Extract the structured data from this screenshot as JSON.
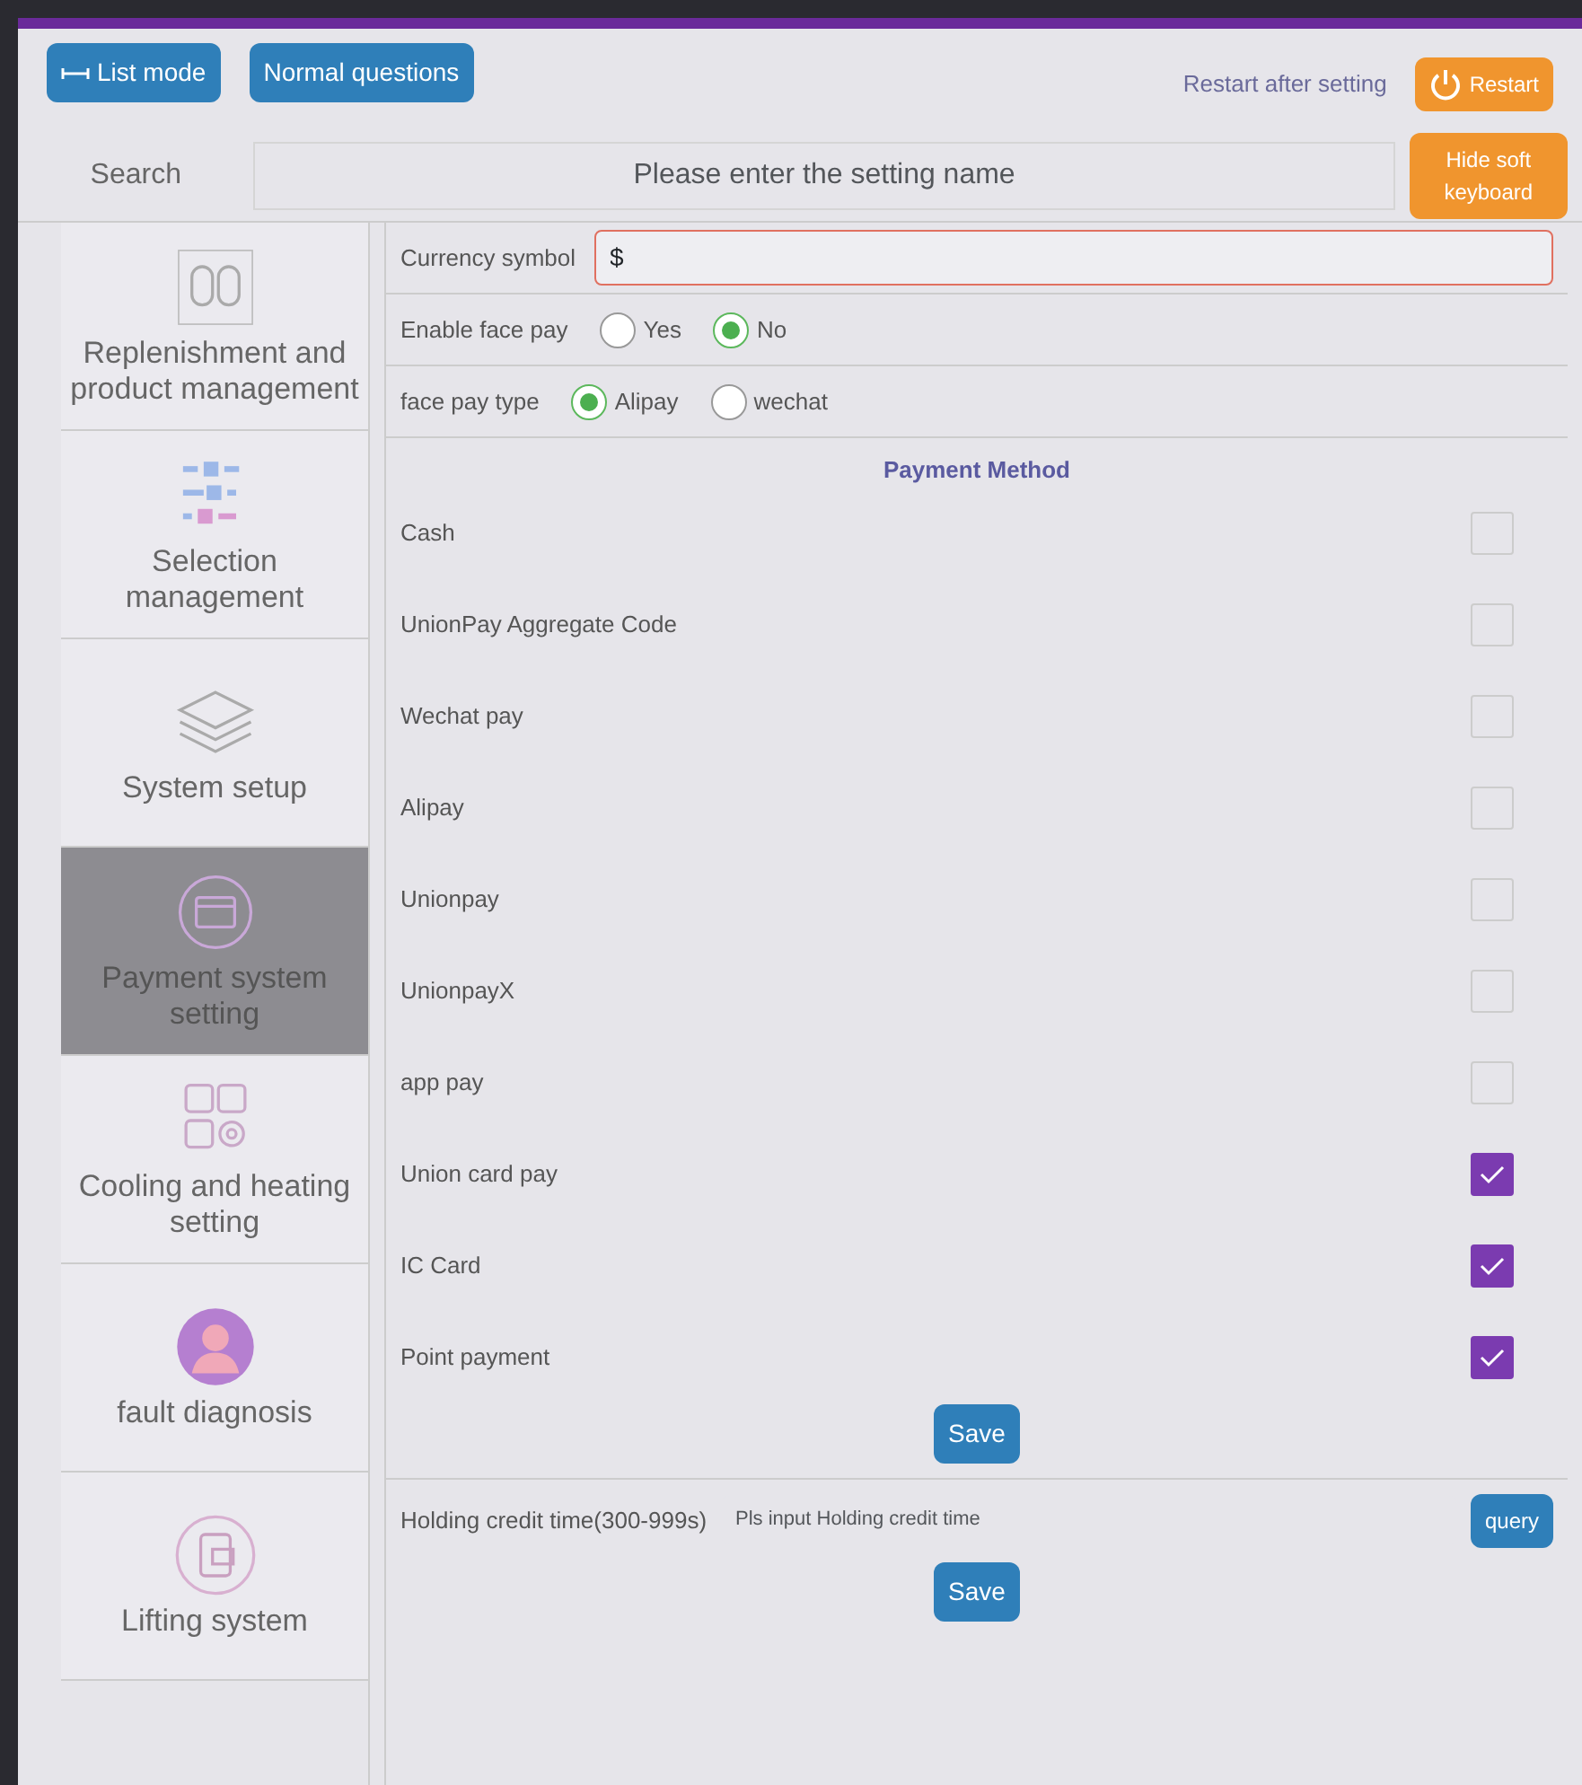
{
  "top_bar": {
    "buttons": [
      {
        "label": "List mode",
        "kind": "list"
      },
      {
        "label": "Normal questions",
        "kind": "plain"
      }
    ],
    "restart_note": "Restart after setting",
    "restart_button": "Restart"
  },
  "search": {
    "label": "Search",
    "placeholder": "Please enter the setting name",
    "keyboard_button": "Hide soft keyboard"
  },
  "sidebar": {
    "items": [
      {
        "label": "Replenishment and product management",
        "selected": false
      },
      {
        "label": "Selection management",
        "selected": false
      },
      {
        "label": "System setup",
        "selected": false
      },
      {
        "label": "Payment system setting",
        "selected": true
      },
      {
        "label": "Cooling and heating setting",
        "selected": false
      },
      {
        "label": "fault diagnosis",
        "selected": false
      },
      {
        "label": "Lifting system",
        "selected": false
      }
    ]
  },
  "currency": {
    "label": "Currency symbol",
    "value": "$"
  },
  "face_pay": {
    "label": "Enable face pay",
    "options": [
      {
        "label": "Yes",
        "selected": false
      },
      {
        "label": "No",
        "selected": true
      }
    ]
  },
  "face_pay_type": {
    "label": "face pay type",
    "options": [
      {
        "label": "Alipay",
        "selected": true
      },
      {
        "label": "wechat",
        "selected": false
      }
    ]
  },
  "payment_methods": {
    "title": "Payment Method",
    "items": [
      {
        "label": "Cash",
        "checked": false
      },
      {
        "label": "UnionPay Aggregate Code",
        "checked": false
      },
      {
        "label": "Wechat pay",
        "checked": false
      },
      {
        "label": "Alipay",
        "checked": false
      },
      {
        "label": "Unionpay",
        "checked": false
      },
      {
        "label": "UnionpayX",
        "checked": false
      },
      {
        "label": "app pay",
        "checked": false
      },
      {
        "label": "Union card pay",
        "checked": true
      },
      {
        "label": "IC Card",
        "checked": true
      },
      {
        "label": "Point payment",
        "checked": true
      }
    ],
    "save_button": "Save"
  },
  "holding_credit": {
    "label": "Holding credit time(300-999s)",
    "placeholder": "Pls input Holding credit time",
    "query_button": "query",
    "save_button": "Save"
  }
}
